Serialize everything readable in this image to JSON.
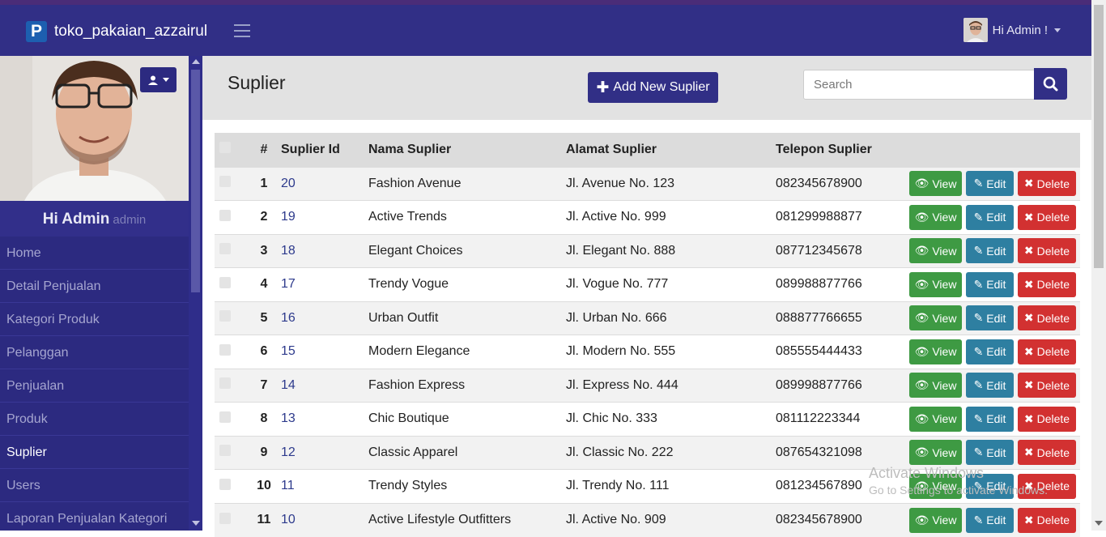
{
  "app": {
    "brand": "toko_pakaian_azzairul",
    "brand_logo": "P",
    "greeting": "Hi Admin !"
  },
  "sidebar": {
    "profile_name": "Hi Admin",
    "profile_role": "admin",
    "items": [
      {
        "label": "Home",
        "active": false
      },
      {
        "label": "Detail Penjualan",
        "active": false
      },
      {
        "label": "Kategori Produk",
        "active": false
      },
      {
        "label": "Pelanggan",
        "active": false
      },
      {
        "label": "Penjualan",
        "active": false
      },
      {
        "label": "Produk",
        "active": false
      },
      {
        "label": "Suplier",
        "active": true
      },
      {
        "label": "Users",
        "active": false
      },
      {
        "label": "Laporan Penjualan Kategori",
        "active": false
      }
    ]
  },
  "main": {
    "title": "Suplier",
    "add_button": "Add New Suplier",
    "search_placeholder": "Search",
    "columns": [
      "#",
      "Suplier Id",
      "Nama Suplier",
      "Alamat Suplier",
      "Telepon Suplier"
    ],
    "actions": {
      "view": "View",
      "edit": "Edit",
      "delete": "Delete"
    },
    "rows": [
      {
        "no": "1",
        "id": "20",
        "nama": "Fashion Avenue",
        "alamat": "Jl. Avenue No. 123",
        "telepon": "082345678900"
      },
      {
        "no": "2",
        "id": "19",
        "nama": "Active Trends",
        "alamat": "Jl. Active No. 999",
        "telepon": "081299988877"
      },
      {
        "no": "3",
        "id": "18",
        "nama": "Elegant Choices",
        "alamat": "Jl. Elegant No. 888",
        "telepon": "087712345678"
      },
      {
        "no": "4",
        "id": "17",
        "nama": "Trendy Vogue",
        "alamat": "Jl. Vogue No. 777",
        "telepon": "089988877766"
      },
      {
        "no": "5",
        "id": "16",
        "nama": "Urban Outfit",
        "alamat": "Jl. Urban No. 666",
        "telepon": "088877766655"
      },
      {
        "no": "6",
        "id": "15",
        "nama": "Modern Elegance",
        "alamat": "Jl. Modern No. 555",
        "telepon": "085555444433"
      },
      {
        "no": "7",
        "id": "14",
        "nama": "Fashion Express",
        "alamat": "Jl. Express No. 444",
        "telepon": "089998877766"
      },
      {
        "no": "8",
        "id": "13",
        "nama": "Chic Boutique",
        "alamat": "Jl. Chic No. 333",
        "telepon": "081112223344"
      },
      {
        "no": "9",
        "id": "12",
        "nama": "Classic Apparel",
        "alamat": "Jl. Classic No. 222",
        "telepon": "087654321098"
      },
      {
        "no": "10",
        "id": "11",
        "nama": "Trendy Styles",
        "alamat": "Jl. Trendy No. 111",
        "telepon": "081234567890"
      },
      {
        "no": "11",
        "id": "10",
        "nama": "Active Lifestyle Outfitters",
        "alamat": "Jl. Active No. 909",
        "telepon": "082345678900"
      }
    ]
  },
  "watermark": {
    "line1": "Activate Windows",
    "line2": "Go to Settings to activate Windows."
  },
  "colors": {
    "navbar": "#312f86",
    "sidebar": "#2c2a80",
    "view": "#3e9a43",
    "edit": "#2e7fa1",
    "delete": "#d23131"
  }
}
